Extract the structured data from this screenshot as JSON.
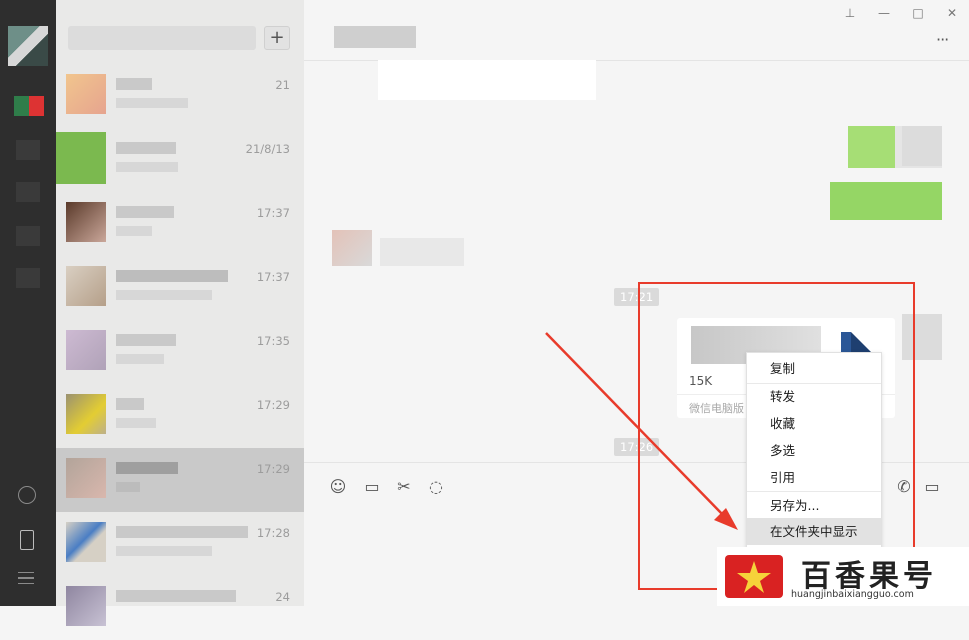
{
  "window": {
    "pin_icon": "pin-icon",
    "minimize_icon": "minimize-icon",
    "maximize_icon": "maximize-icon",
    "close_icon": "close-icon"
  },
  "sidebar": {
    "bottom_icons": [
      "miniprogram-icon",
      "phone-icon",
      "menu-icon"
    ]
  },
  "chat_list": {
    "add_label": "+",
    "items": [
      {
        "time": "21"
      },
      {
        "time": "21/8/13"
      },
      {
        "time": "17:37"
      },
      {
        "time": "17:37"
      },
      {
        "time": "17:35"
      },
      {
        "time": "17:29"
      },
      {
        "time": "17:29",
        "selected": true
      },
      {
        "time": "17:28"
      },
      {
        "time": "24"
      }
    ]
  },
  "chat": {
    "more_label": "···",
    "timestamps": [
      "17:21",
      "17:26"
    ],
    "file_message": {
      "size": "15K",
      "source": "微信电脑版"
    },
    "toolbar_icons": [
      "emoji-icon",
      "folder-icon",
      "scissors-icon",
      "chat-history-icon",
      "phone-call-icon",
      "video-call-icon"
    ]
  },
  "context_menu": {
    "items": [
      "复制",
      "转发",
      "收藏",
      "多选",
      "引用",
      "另存为...",
      "在文件夹中显示"
    ]
  },
  "watermark": {
    "title": "百香果号",
    "url": "huangjinbaixiangguo.com"
  },
  "colors": {
    "annotation_red": "#e83b2b",
    "sidebar_bg": "#2e2e2e",
    "list_bg": "#e9e9e8",
    "chat_bg": "#f5f5f5",
    "menu_highlight": "#e2e2e2"
  }
}
